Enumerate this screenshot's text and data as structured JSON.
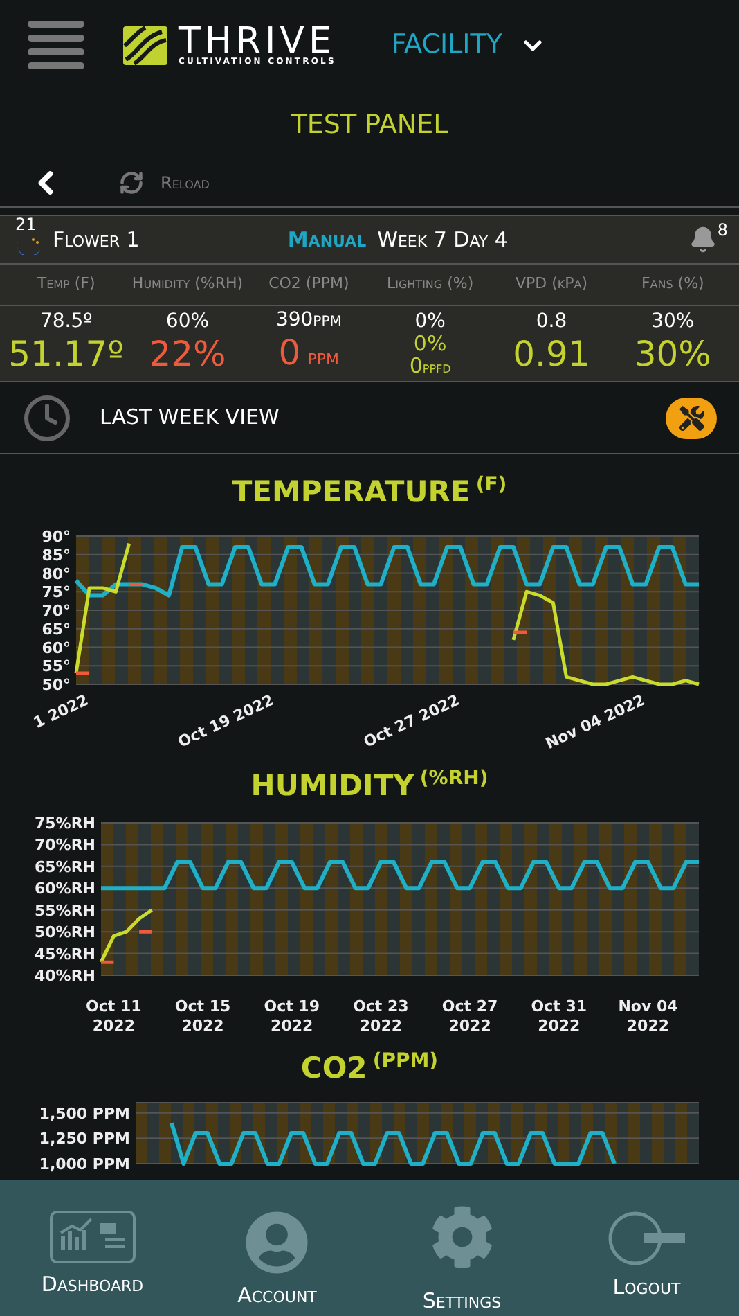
{
  "header": {
    "logo": {
      "name": "THRIVE",
      "tagline": "CULTIVATION CONTROLS"
    },
    "facility": "FACILITY"
  },
  "panel_title": "TEST PANEL",
  "toolbar": {
    "reload": "Reload"
  },
  "room": {
    "badge": "21",
    "name": "Flower 1",
    "mode": "Manual",
    "schedule": "Week 7 Day 4",
    "alerts": "8"
  },
  "metrics": [
    {
      "kind": "single",
      "label": "Temp (F)",
      "setpoint": "78.5º",
      "value": "51.17º",
      "alarm": false
    },
    {
      "kind": "single",
      "label": "Humidity (%RH)",
      "setpoint": "60%",
      "value": "22%",
      "alarm": true
    },
    {
      "kind": "single",
      "label": "CO2 (PPM)",
      "setpoint": "390ppm",
      "value": "0",
      "unit": "ppm",
      "alarm": true
    },
    {
      "kind": "stacked",
      "label": "Lighting (%)",
      "setpoint": "0%",
      "value": "0%",
      "sub_value": "0",
      "sub_unit": "ppfd",
      "alarm": false
    },
    {
      "kind": "single",
      "label": "VPD (kPa)",
      "setpoint": "0.8",
      "value": "0.91",
      "alarm": false
    },
    {
      "kind": "single",
      "label": "Fans (%)",
      "setpoint": "30%",
      "value": "30%",
      "alarm": false
    }
  ],
  "view_bar": {
    "label": "LAST WEEK VIEW"
  },
  "charts": [
    {
      "title": "TEMPERATURE",
      "unit": "(F)",
      "chart_data": {
        "type": "line",
        "grid": true,
        "categories": [
          null,
          "1 2022",
          null,
          null,
          null,
          null,
          null,
          null,
          null,
          null,
          null,
          null,
          null,
          null,
          null,
          "Oct 19 2022",
          null,
          null,
          null,
          null,
          null,
          null,
          null,
          null,
          null,
          null,
          null,
          null,
          null,
          "Oct 27 2022",
          null,
          null,
          null,
          null,
          null,
          null,
          null,
          null,
          null,
          null,
          null,
          null,
          null,
          "Nov 04 2022",
          null,
          null,
          null,
          null
        ],
        "ylim": [
          50,
          90
        ],
        "yticks": [
          {
            "value": 50,
            "label": "50°"
          },
          {
            "value": 55,
            "label": "55°"
          },
          {
            "value": 60,
            "label": "60°"
          },
          {
            "value": 65,
            "label": "65°"
          },
          {
            "value": 70,
            "label": "70°"
          },
          {
            "value": 75,
            "label": "75°"
          },
          {
            "value": 80,
            "label": "80°"
          },
          {
            "value": 85,
            "label": "85°"
          },
          {
            "value": 90,
            "label": "90°"
          }
        ],
        "series": [
          {
            "color": "#1fb0c8",
            "values": [
              78,
              74,
              74,
              77,
              77,
              77,
              76,
              74,
              87,
              87,
              77,
              77,
              87,
              87,
              77,
              77,
              87,
              87,
              77,
              77,
              87,
              87,
              77,
              77,
              87,
              87,
              77,
              77,
              87,
              87,
              77,
              77,
              87,
              87,
              77,
              77,
              87,
              87,
              77,
              77,
              87,
              87,
              77,
              77,
              87,
              87,
              77,
              77
            ]
          },
          {
            "color": "#c9dc2b",
            "values": [
              53,
              76,
              76,
              75,
              88,
              null,
              null,
              null,
              null,
              null,
              null,
              null,
              null,
              null,
              null,
              null,
              null,
              null,
              null,
              null,
              null,
              null,
              null,
              null,
              null,
              null,
              null,
              null,
              null,
              null,
              null,
              null,
              null,
              62,
              75,
              74,
              72,
              52,
              51,
              50,
              50,
              51,
              52,
              51,
              50,
              50,
              51,
              50
            ]
          },
          {
            "color": "#f05a3c",
            "values": [
              53,
              53,
              null,
              null,
              77,
              77,
              null,
              null,
              null,
              null,
              null,
              null,
              null,
              null,
              null,
              null,
              null,
              null,
              null,
              null,
              null,
              null,
              null,
              null,
              null,
              null,
              null,
              null,
              null,
              null,
              null,
              null,
              null,
              64,
              64,
              null,
              null,
              null,
              null,
              null,
              null,
              null,
              null,
              null,
              null,
              null,
              null,
              null
            ]
          }
        ]
      }
    },
    {
      "title": "HUMIDITY",
      "unit": "(%RH)",
      "chart_data": {
        "type": "line",
        "grid": true,
        "categories": [
          null,
          "Oct 11 2022",
          null,
          null,
          null,
          null,
          null,
          null,
          "Oct 15 2022",
          null,
          null,
          null,
          null,
          null,
          null,
          "Oct 19 2022",
          null,
          null,
          null,
          null,
          null,
          null,
          "Oct 23 2022",
          null,
          null,
          null,
          null,
          null,
          null,
          "Oct 27 2022",
          null,
          null,
          null,
          null,
          null,
          null,
          "Oct 31 2022",
          null,
          null,
          null,
          null,
          null,
          null,
          "Nov 04 2022",
          null,
          null,
          null,
          null
        ],
        "ylim": [
          40,
          75
        ],
        "yticks": [
          {
            "value": 40,
            "label": "40%RH"
          },
          {
            "value": 45,
            "label": "45%RH"
          },
          {
            "value": 50,
            "label": "50%RH"
          },
          {
            "value": 55,
            "label": "55%RH"
          },
          {
            "value": 60,
            "label": "60%RH"
          },
          {
            "value": 65,
            "label": "65%RH"
          },
          {
            "value": 70,
            "label": "70%RH"
          },
          {
            "value": 75,
            "label": "75%RH"
          }
        ],
        "series": [
          {
            "color": "#1fb0c8",
            "values": [
              60,
              60,
              60,
              60,
              60,
              60,
              66,
              66,
              60,
              60,
              66,
              66,
              60,
              60,
              66,
              66,
              60,
              60,
              66,
              66,
              60,
              60,
              66,
              66,
              60,
              60,
              66,
              66,
              60,
              60,
              66,
              66,
              60,
              60,
              66,
              66,
              60,
              60,
              66,
              66,
              60,
              60,
              66,
              66,
              60,
              60,
              66,
              66
            ]
          },
          {
            "color": "#c9dc2b",
            "values": [
              43,
              49,
              50,
              53,
              55,
              null,
              null,
              null,
              null,
              null,
              null,
              null,
              null,
              null,
              null,
              null,
              null,
              null,
              null,
              null,
              null,
              null,
              null,
              null,
              null,
              null,
              null,
              null,
              null,
              null,
              null,
              null,
              null,
              null,
              null,
              null,
              null,
              null,
              null,
              null,
              null,
              null,
              null,
              null,
              null,
              null,
              null,
              null
            ]
          },
          {
            "color": "#f05a3c",
            "values": [
              43,
              43,
              null,
              50,
              50,
              null,
              null,
              null,
              null,
              null,
              null,
              null,
              null,
              null,
              null,
              null,
              null,
              null,
              null,
              null,
              null,
              null,
              null,
              null,
              null,
              null,
              null,
              null,
              null,
              null,
              null,
              null,
              null,
              null,
              null,
              null,
              null,
              null,
              null,
              null,
              null,
              null,
              null,
              null,
              null,
              null,
              null,
              null
            ]
          }
        ]
      }
    },
    {
      "title": "CO2",
      "unit": "(PPM)",
      "chart_data": {
        "type": "line",
        "grid": true,
        "ylim": [
          1000,
          1600
        ],
        "yticks": [
          {
            "value": 1000,
            "label": "1,000 PPM"
          },
          {
            "value": 1250,
            "label": "1,250 PPM"
          },
          {
            "value": 1500,
            "label": "1,500 PPM"
          }
        ],
        "series": [
          {
            "color": "#1fb0c8",
            "values": [
              1400,
              1000,
              1300,
              1300,
              1000,
              1000,
              1300,
              1300,
              1000,
              1000,
              1300,
              1300,
              1000,
              1000,
              1300,
              1300,
              1000,
              1000,
              1300,
              1300,
              1000,
              1000,
              1300,
              1300,
              1000,
              1000,
              1300,
              1300,
              1000,
              1000,
              1300,
              1300,
              1000,
              1000,
              1000,
              1300,
              1300,
              1000
            ]
          }
        ]
      }
    }
  ],
  "nav": [
    {
      "kind": "dashboard",
      "label": "Dashboard"
    },
    {
      "kind": "account",
      "label": "Account"
    },
    {
      "kind": "settings",
      "label": "Settings"
    },
    {
      "kind": "logout",
      "label": "Logout"
    }
  ]
}
